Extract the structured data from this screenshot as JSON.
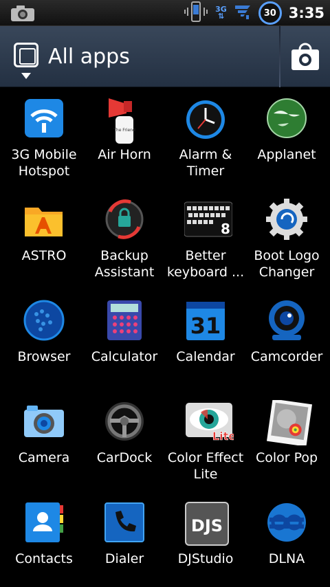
{
  "statusbar": {
    "time": "3:35",
    "battery": "30",
    "network": "3G"
  },
  "titlebar": {
    "title": "All apps"
  },
  "apps": [
    {
      "label": "3G Mobile Hotspot",
      "icon": "wifi-hotspot-icon"
    },
    {
      "label": "Air Horn",
      "icon": "air-horn-icon"
    },
    {
      "label": "Alarm & Timer",
      "icon": "alarm-clock-icon"
    },
    {
      "label": "Applanet",
      "icon": "globe-icon"
    },
    {
      "label": "ASTRO",
      "icon": "folder-icon"
    },
    {
      "label": "Backup Assistant",
      "icon": "backup-lock-icon"
    },
    {
      "label": "Better keyboard ...",
      "icon": "keyboard-icon"
    },
    {
      "label": "Boot Logo Changer",
      "icon": "gear-icon"
    },
    {
      "label": "Browser",
      "icon": "browser-globe-icon"
    },
    {
      "label": "Calculator",
      "icon": "calculator-icon"
    },
    {
      "label": "Calendar",
      "icon": "calendar-icon",
      "text": "31"
    },
    {
      "label": "Camcorder",
      "icon": "camcorder-icon"
    },
    {
      "label": "Camera",
      "icon": "camera-icon"
    },
    {
      "label": "CarDock",
      "icon": "steering-wheel-icon"
    },
    {
      "label": "Color Effect Lite",
      "icon": "eye-icon",
      "text": "Lite"
    },
    {
      "label": "Color Pop",
      "icon": "photo-icon"
    },
    {
      "label": "Contacts",
      "icon": "contacts-icon"
    },
    {
      "label": "Dialer",
      "icon": "phone-icon"
    },
    {
      "label": "DJStudio",
      "icon": "dj-icon",
      "text": "DJS"
    },
    {
      "label": "DLNA",
      "icon": "dlna-icon"
    }
  ]
}
